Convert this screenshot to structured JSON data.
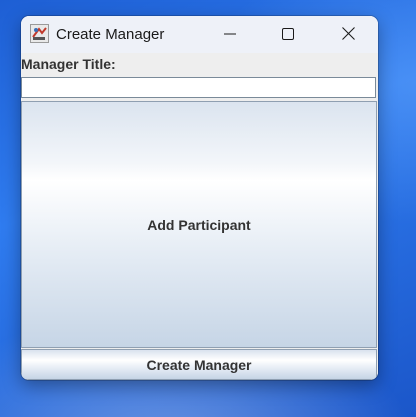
{
  "window": {
    "title": "Create Manager",
    "minimize_icon": "minimize-icon",
    "maximize_icon": "maximize-icon",
    "close_icon": "close-icon",
    "app_icon": "java-app-icon"
  },
  "form": {
    "manager_title_label": "Manager Title:",
    "manager_title_value": "",
    "add_participant_label": "Add Participant",
    "create_manager_label": "Create Manager"
  },
  "colors": {
    "desktop_accent": "#2f7cf0",
    "button_border": "#8f9fb1",
    "text": "#333333"
  }
}
